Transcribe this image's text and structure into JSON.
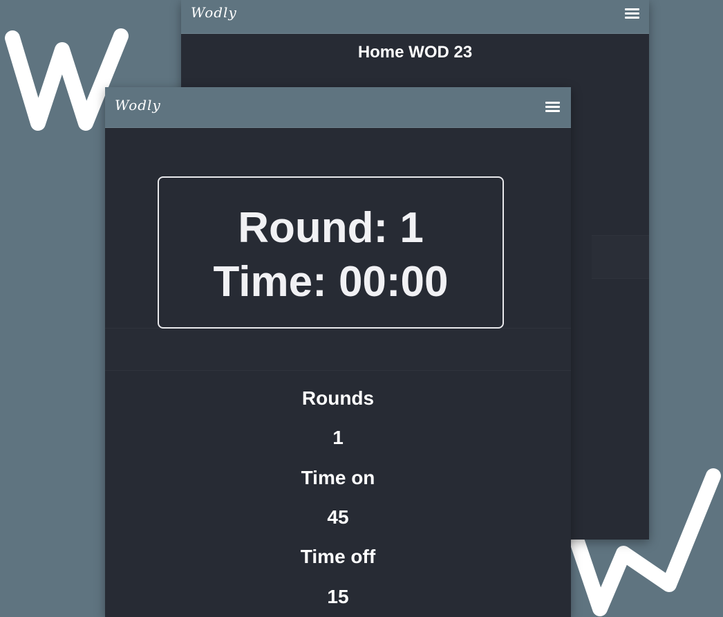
{
  "back_screen": {
    "logo": "Wodly",
    "title": "Home WOD 23",
    "menu_icon": "hamburger-menu-icon"
  },
  "front_screen": {
    "logo": "Wodly",
    "menu_icon": "hamburger-menu-icon",
    "timer": {
      "round_text": "Round: 1",
      "time_text": "Time: 00:00"
    },
    "settings": {
      "rounds_label": "Rounds",
      "rounds_value": "1",
      "time_on_label": "Time on",
      "time_on_value": "45",
      "time_off_label": "Time off",
      "time_off_value": "15"
    }
  },
  "colors": {
    "background": "#5f7480",
    "screen": "#272b34",
    "text": "#ffffff"
  }
}
